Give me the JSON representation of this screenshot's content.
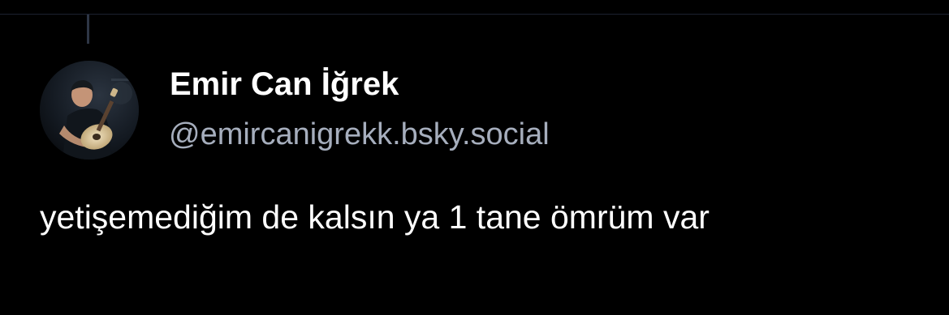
{
  "post": {
    "author": {
      "display_name": "Emir Can İğrek",
      "handle": "@emircanigrekk.bsky.social",
      "avatar_alt": "Emir Can İğrek"
    },
    "text": "yetişemediğim de kalsın ya 1 tane ömrüm var"
  },
  "colors": {
    "background": "#000000",
    "name": "#ffffff",
    "handle": "#a6aebd",
    "text": "#ffffff",
    "thread_line": "#2e3645"
  }
}
